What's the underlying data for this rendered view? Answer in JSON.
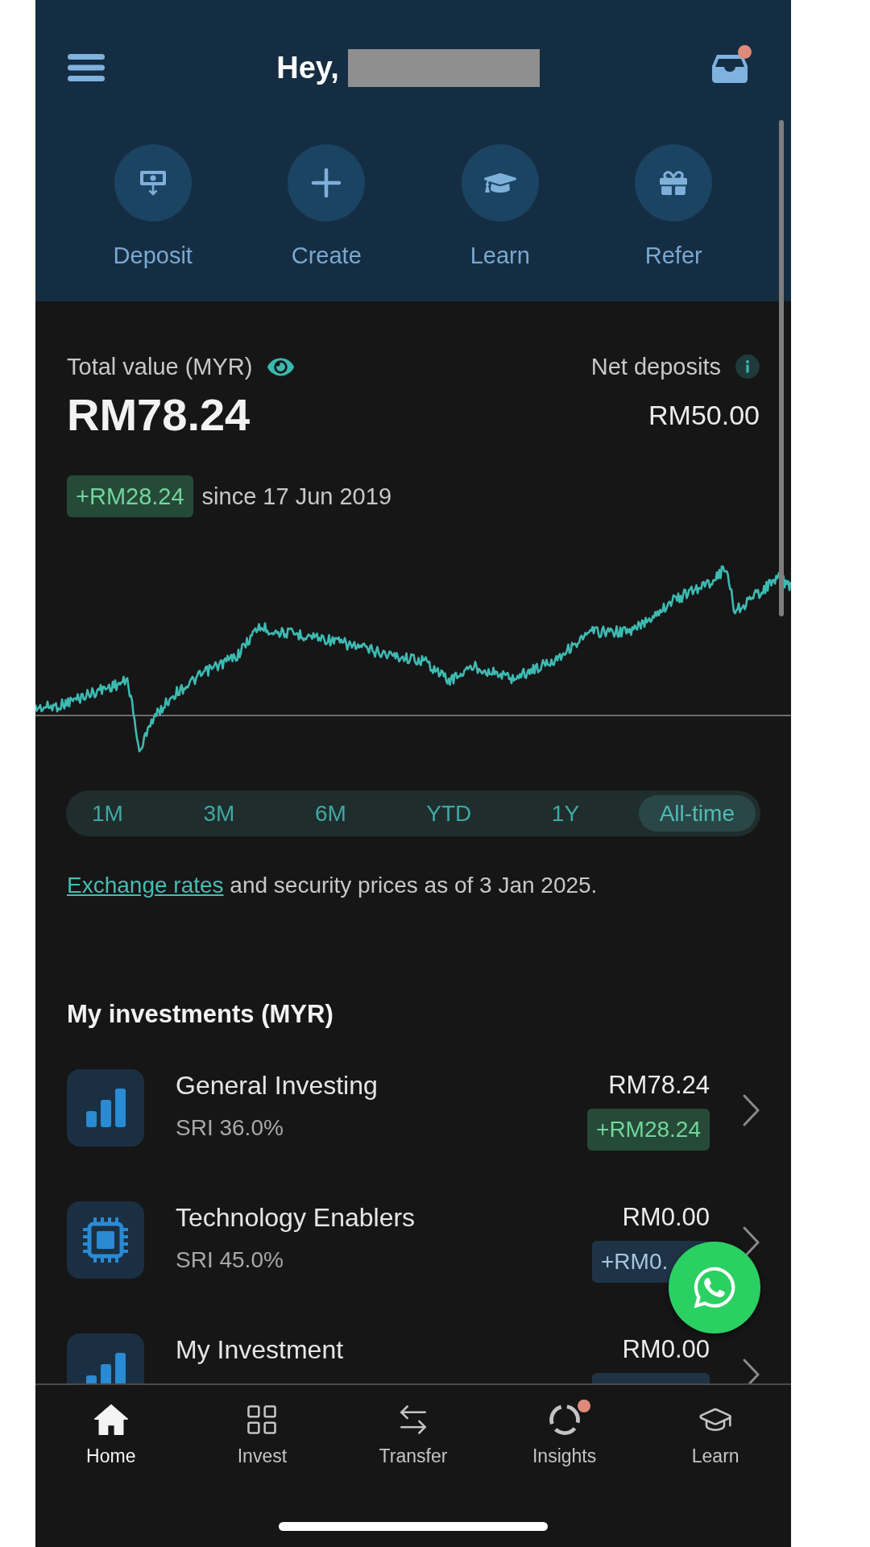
{
  "header": {
    "greeting": "Hey,",
    "inbox_unread": true
  },
  "quick_actions": [
    {
      "label": "Deposit"
    },
    {
      "label": "Create"
    },
    {
      "label": "Learn"
    },
    {
      "label": "Refer"
    }
  ],
  "summary": {
    "total_label": "Total value (MYR)",
    "total_value": "RM78.24",
    "net_label": "Net deposits",
    "net_value": "RM50.00",
    "change": "+RM28.24",
    "since": "since 17 Jun 2019"
  },
  "ranges": [
    {
      "label": "1M",
      "selected": false
    },
    {
      "label": "3M",
      "selected": false
    },
    {
      "label": "6M",
      "selected": false
    },
    {
      "label": "YTD",
      "selected": false
    },
    {
      "label": "1Y",
      "selected": false
    },
    {
      "label": "All-time",
      "selected": true
    }
  ],
  "footnote": {
    "link": "Exchange rates",
    "text": "and security prices as of 3 Jan 2025."
  },
  "investments": {
    "title": "My investments (MYR)",
    "items": [
      {
        "name": "General Investing",
        "sri": "SRI 36.0%",
        "value": "RM78.24",
        "change": "+RM28.24",
        "gain": true
      },
      {
        "name": "Technology Enablers",
        "sri": "SRI 45.0%",
        "value": "RM0.00",
        "change": "+RM0.",
        "gain": false
      },
      {
        "name": "My Investment",
        "value": "RM0.00",
        "gain": false
      }
    ]
  },
  "nav": [
    {
      "label": "Home",
      "selected": true,
      "notification": false
    },
    {
      "label": "Invest",
      "selected": false,
      "notification": false
    },
    {
      "label": "Transfer",
      "selected": false,
      "notification": false
    },
    {
      "label": "Insights",
      "selected": false,
      "notification": true
    },
    {
      "label": "Learn",
      "selected": false,
      "notification": false
    }
  ]
}
